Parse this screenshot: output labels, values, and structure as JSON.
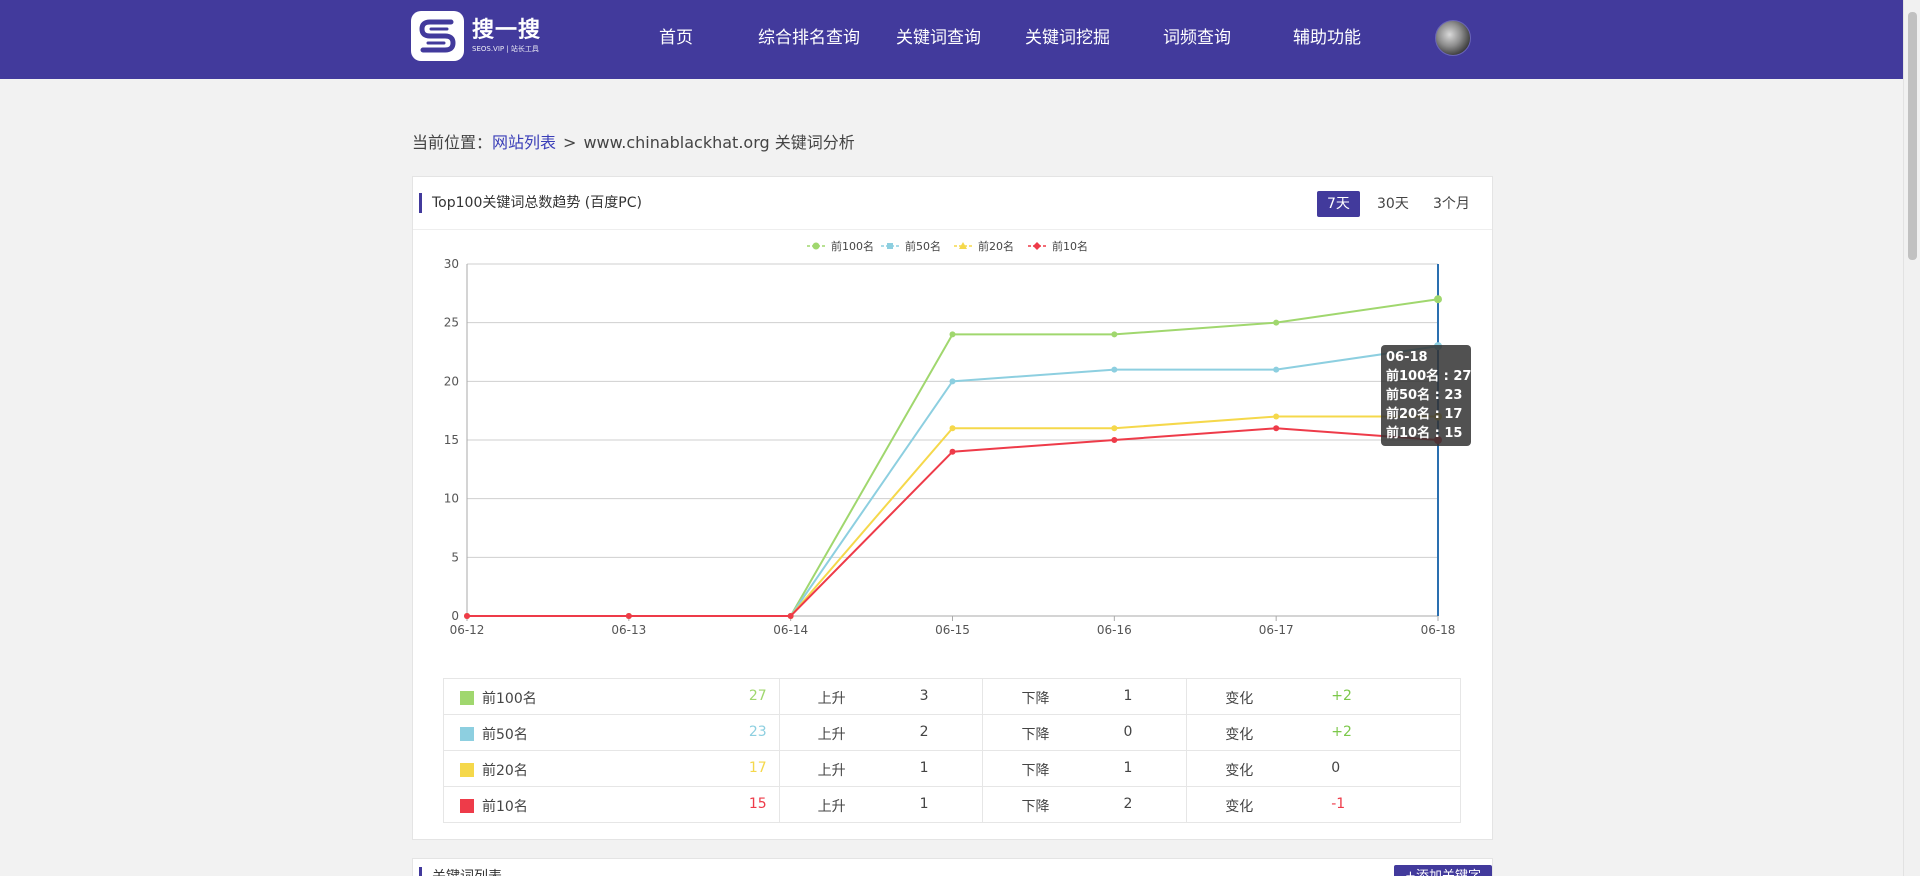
{
  "header": {
    "logo_title": "搜一搜",
    "logo_subtitle": "SEOS.VIP | 站长工具",
    "nav": [
      "首页",
      "综合排名查询",
      "关键词查询",
      "关键词挖掘",
      "词频查询",
      "辅助功能"
    ]
  },
  "breadcrumb": {
    "prefix": "当前位置：",
    "link": "网站列表",
    "separator": ">",
    "current": "www.chinablackhat.org 关键词分析"
  },
  "trend_card": {
    "title": "Top100关键词总数趋势 (百度PC)",
    "ranges": [
      "7天",
      "30天",
      "3个月"
    ],
    "active_range": "7天"
  },
  "tooltip": {
    "date": "06-18",
    "lines": [
      "前100名 : 27",
      "前50名 : 23",
      "前20名 : 17",
      "前10名 : 15"
    ]
  },
  "stats": [
    {
      "name": "前100名",
      "count": "27",
      "color": "#a0d76e",
      "up_label": "上升",
      "up": "3",
      "down_label": "下降",
      "down": "1",
      "change_label": "变化",
      "change": "+2",
      "change_color": "#7cc84a"
    },
    {
      "name": "前50名",
      "count": "23",
      "color": "#8dcfe0",
      "up_label": "上升",
      "up": "2",
      "down_label": "下降",
      "down": "0",
      "change_label": "变化",
      "change": "+2",
      "change_color": "#7cc84a"
    },
    {
      "name": "前20名",
      "count": "17",
      "color": "#f5d84b",
      "up_label": "上升",
      "up": "1",
      "down_label": "下降",
      "down": "1",
      "change_label": "变化",
      "change": "0",
      "change_color": "#444444"
    },
    {
      "name": "前10名",
      "count": "15",
      "color": "#ee3b49",
      "up_label": "上升",
      "up": "1",
      "down_label": "下降",
      "down": "2",
      "change_label": "变化",
      "change": "-1",
      "change_color": "#ee3b49"
    }
  ],
  "keyword_section": {
    "title": "关键词列表",
    "add_button": "+添加关键字"
  },
  "chart_data": {
    "type": "line",
    "x": [
      "06-12",
      "06-13",
      "06-14",
      "06-15",
      "06-16",
      "06-17",
      "06-18"
    ],
    "ylim": [
      0,
      30
    ],
    "yticks": [
      "0",
      "5",
      "10",
      "15",
      "20",
      "25",
      "30"
    ],
    "series": [
      {
        "name": "前100名",
        "values": [
          0,
          0,
          0,
          24,
          24,
          25,
          27
        ],
        "color": "#a0d76e",
        "marker": "circle"
      },
      {
        "name": "前50名",
        "values": [
          0,
          0,
          0,
          20,
          21,
          21,
          23
        ],
        "color": "#8dcfe0",
        "marker": "square"
      },
      {
        "name": "前20名",
        "values": [
          0,
          0,
          0,
          16,
          16,
          17,
          17
        ],
        "color": "#f5d84b",
        "marker": "triangle"
      },
      {
        "name": "前10名",
        "values": [
          0,
          0,
          0,
          14,
          15,
          16,
          15
        ],
        "color": "#ee3b49",
        "marker": "diamond"
      }
    ],
    "legend_position": "top-center",
    "grid": true
  }
}
